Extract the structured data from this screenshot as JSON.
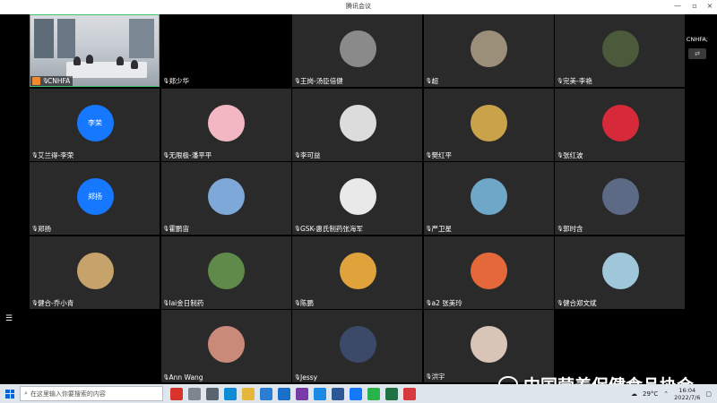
{
  "window": {
    "title": "腾讯会议",
    "controls": [
      "—",
      "▫",
      "×"
    ]
  },
  "stage": {
    "speaking_text": "正在讲话: CNHFA;",
    "share_icon": "share-screen-icon",
    "menu_icon": "menu-icon"
  },
  "participants": [
    {
      "name": "CNHFA",
      "type": "video"
    },
    {
      "name": "郑少华",
      "type": "black"
    },
    {
      "name": "王岗-汤臣倍健",
      "type": "avatar",
      "color": "#8a8a8a"
    },
    {
      "name": "超",
      "type": "avatar",
      "color": "#9c8f7a"
    },
    {
      "name": "完美-李艳",
      "type": "avatar",
      "color": "#4a5a3a"
    },
    {
      "name": "艾兰得-李荣",
      "type": "avatar",
      "initials": "李荣",
      "color": "#1677ff"
    },
    {
      "name": "无限极-潘平平",
      "type": "avatar",
      "color": "#f2b7c3"
    },
    {
      "name": "李可益",
      "type": "avatar",
      "color": "#dcdcdc"
    },
    {
      "name": "樊红平",
      "type": "avatar",
      "color": "#c9a24a"
    },
    {
      "name": "张红波",
      "type": "avatar",
      "color": "#d62a3a"
    },
    {
      "name": "郑扬",
      "type": "avatar",
      "initials": "郑扬",
      "color": "#1677ff"
    },
    {
      "name": "霍鹏宙",
      "type": "avatar",
      "color": "#7ea8d8"
    },
    {
      "name": "GSK-惠氏制药张海军",
      "type": "avatar",
      "color": "#e9e9e9"
    },
    {
      "name": "严卫星",
      "type": "avatar",
      "color": "#6fa7c9"
    },
    {
      "name": "郭时含",
      "type": "avatar",
      "color": "#5c6a85"
    },
    {
      "name": "健合-乔小青",
      "type": "avatar",
      "color": "#c6a36a"
    },
    {
      "name": "lai金日制药",
      "type": "avatar",
      "color": "#5f8a4a"
    },
    {
      "name": "陈鹏",
      "type": "avatar",
      "color": "#e0a23a"
    },
    {
      "name": "a2 张美玲",
      "type": "avatar",
      "color": "#e5683a"
    },
    {
      "name": "健合郑文斌",
      "type": "avatar",
      "color": "#9fc7d9"
    },
    {
      "name": "",
      "type": "black"
    },
    {
      "name": "Ann Wang",
      "type": "avatar",
      "color": "#c98a7a"
    },
    {
      "name": "Jessy",
      "type": "avatar",
      "color": "#3c4a6a"
    },
    {
      "name": "洪宇",
      "type": "avatar",
      "color": "#d9c4b8"
    },
    {
      "name": "",
      "type": "black"
    }
  ],
  "watermark": {
    "text": "中国营养保健食品协会",
    "icon": "wechat-icon"
  },
  "taskbar": {
    "search_placeholder": "在这里输入你要搜索的内容",
    "weather": "29°C",
    "time": "16:04",
    "date": "2022/7/6",
    "apps": [
      {
        "icon": "meeting-icon",
        "color": "#d9342b"
      },
      {
        "icon": "task-view-icon",
        "color": "#7d8590"
      },
      {
        "icon": "tools-icon",
        "color": "#5a6470"
      },
      {
        "icon": "edge-icon",
        "color": "#0f8bd6"
      },
      {
        "icon": "folder-icon",
        "color": "#e6b73a"
      },
      {
        "icon": "store-icon",
        "color": "#2b7cd3"
      },
      {
        "icon": "mail-icon",
        "color": "#1a6fc9"
      },
      {
        "icon": "onenote-icon",
        "color": "#7a3aa8"
      },
      {
        "icon": "ie-icon",
        "color": "#1e88e5"
      },
      {
        "icon": "word-icon",
        "color": "#2b5797"
      },
      {
        "icon": "tencent-meeting-icon",
        "color": "#1677ff"
      },
      {
        "icon": "wechat-app-icon",
        "color": "#2ab24b"
      },
      {
        "icon": "excel-icon",
        "color": "#1f7244"
      },
      {
        "icon": "wps-icon",
        "color": "#d8393a"
      }
    ]
  }
}
